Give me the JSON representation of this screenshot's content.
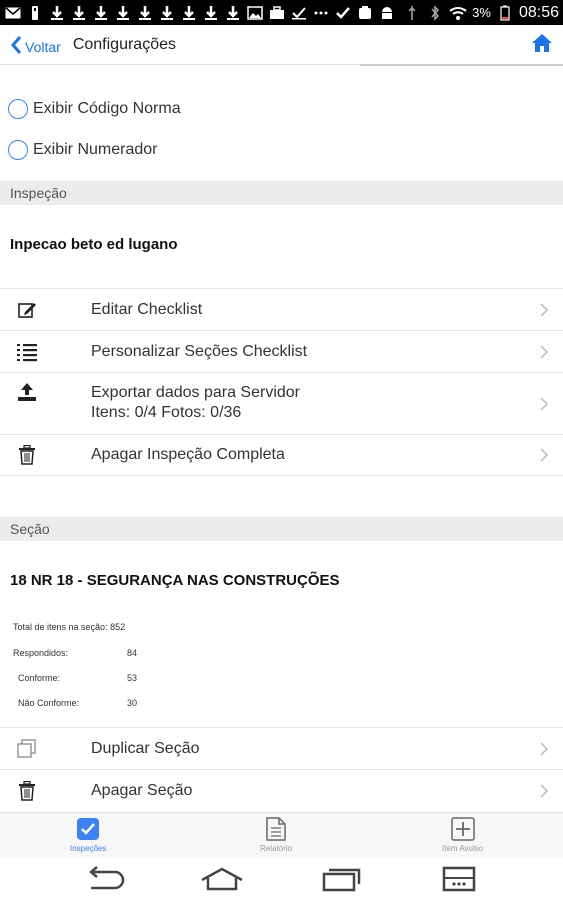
{
  "status_bar": {
    "icons": [
      "mail-icon",
      "usb-icon",
      "download-icon",
      "download-icon",
      "download-icon",
      "download-icon",
      "download-icon",
      "download-icon",
      "download-icon",
      "download-icon",
      "download-icon",
      "image-icon",
      "briefcase-icon",
      "check-icon",
      "dots-icon",
      "check-icon",
      "clipboard-icon",
      "android-icon",
      "usb-icon",
      "bluetooth-icon",
      "wifi-icon",
      "battery-icon"
    ],
    "battery": "3%",
    "time": "08:56"
  },
  "nav": {
    "back_label": "Voltar",
    "title": "Configurações"
  },
  "options": [
    {
      "label": "Exibir Código Norma",
      "checked": false
    },
    {
      "label": "Exibir Numerador",
      "checked": false
    }
  ],
  "inspection": {
    "header": "Inspeção",
    "name": "Inpecao beto ed lugano",
    "actions": [
      {
        "label": "Editar Checklist",
        "icon": "edit-icon"
      },
      {
        "label": "Personalizar Seções Checklist",
        "icon": "list-icon"
      },
      {
        "label": "Exportar dados para Servidor",
        "sub": "Itens: 0/4 Fotos: 0/36",
        "icon": "upload-icon"
      },
      {
        "label": "Apagar Inspeção Completa",
        "icon": "trash-icon"
      }
    ]
  },
  "section": {
    "header": "Seção",
    "name": "18 NR 18 - SEGURANÇA NAS CONSTRUÇÕES",
    "stats": [
      {
        "label": "Total de itens na seção:",
        "value": "852"
      },
      {
        "label": "Respondidos:",
        "value": "84"
      },
      {
        "label": "Conforme:",
        "value": "53"
      },
      {
        "label": "Não Conforme:",
        "value": "30"
      }
    ],
    "actions": [
      {
        "label": "Duplicar Seção",
        "icon": "copy-icon"
      },
      {
        "label": "Apagar Seção",
        "icon": "trash-icon"
      }
    ]
  },
  "tabs": [
    {
      "label": "Inspeções",
      "icon": "checkbox-icon",
      "active": true
    },
    {
      "label": "Relatório",
      "icon": "document-icon",
      "active": false
    },
    {
      "label": "Item Avulso",
      "icon": "plus-box-icon",
      "active": false
    }
  ],
  "colors": {
    "accent": "#3b82f6",
    "header_bg": "#ececec",
    "status_bar": "#000000"
  }
}
